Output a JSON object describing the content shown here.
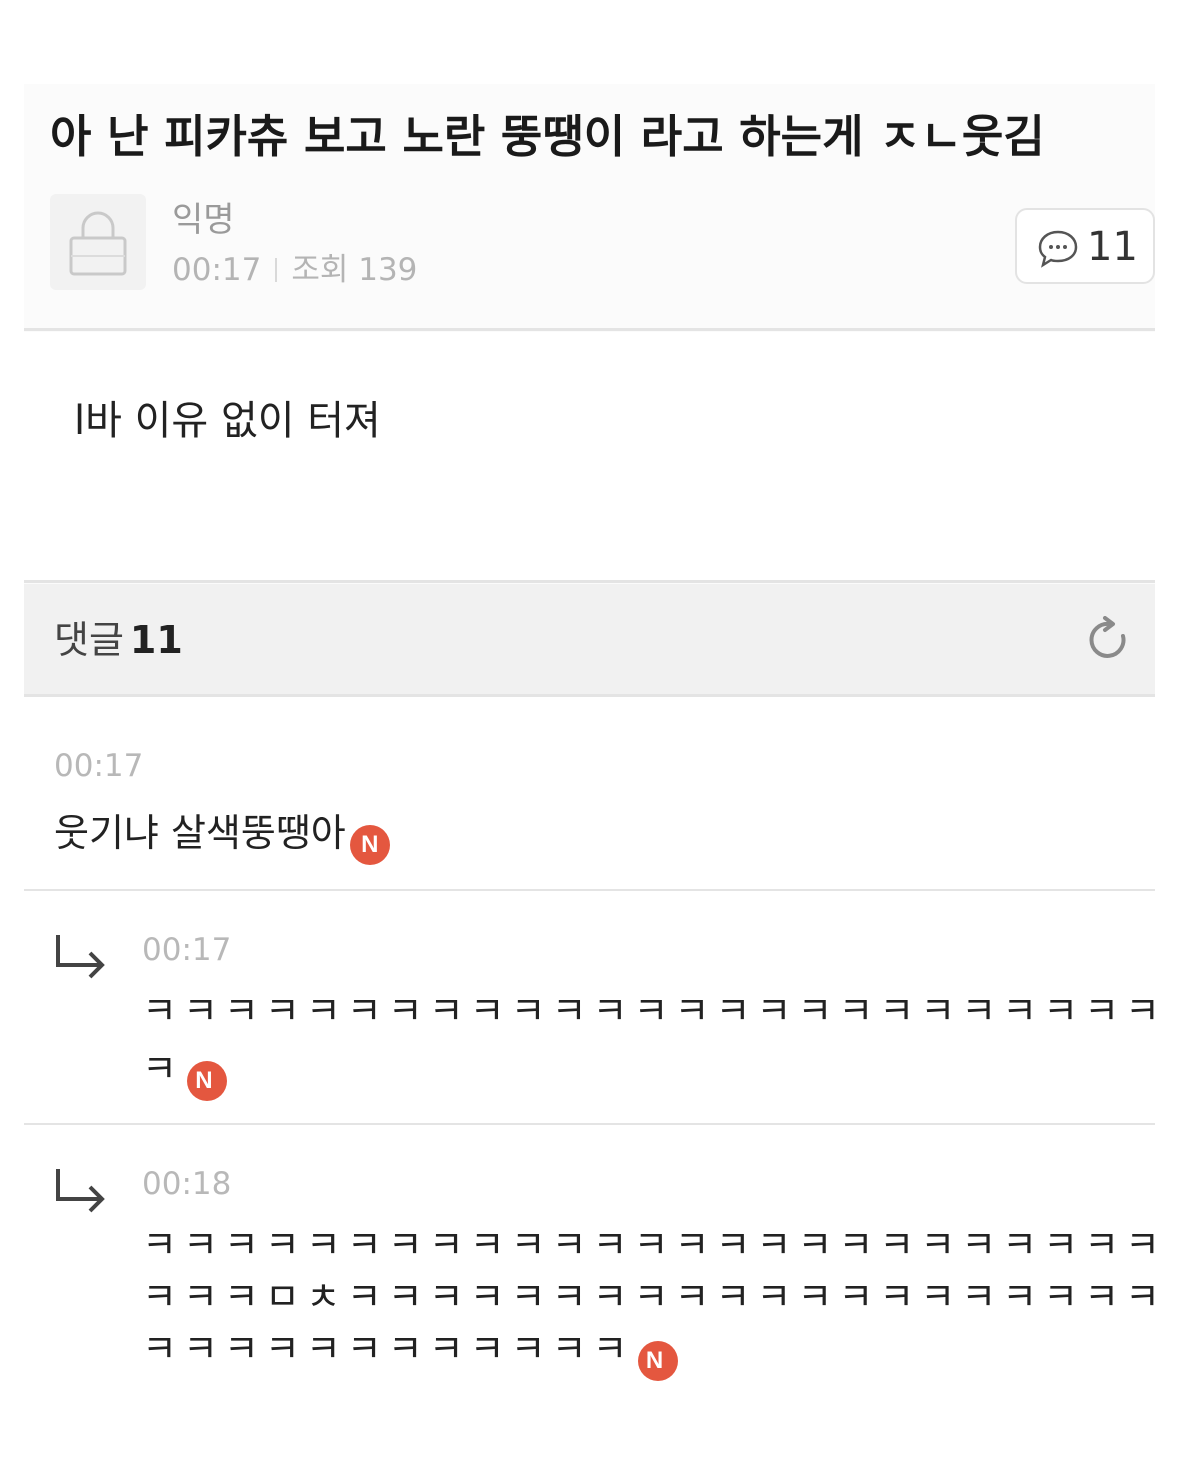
{
  "post": {
    "title": "아 난 피카츄 보고 노란 뚱땡이 라고 하는게 ㅈㄴ웃김",
    "author": "익명",
    "time": "00:17",
    "views_label": "조회 139",
    "comment_count": "11",
    "body": "l바 이유 없이 터져"
  },
  "comments_section": {
    "label": "댓글",
    "count": "11"
  },
  "comments": [
    {
      "time": "00:17",
      "text": "웃기냐 살색뚱땡아",
      "badge": "N"
    },
    {
      "time": "00:17",
      "lines": [
        "ㅋㅋㅋㅋㅋㅋㅋㅋㅋㅋㅋㅋㅋㅋㅋㅋㅋㅋㅋㅋㅋㅋㅋㅋㅋㅋ",
        "ㅋ"
      ],
      "badge": "N"
    },
    {
      "time": "00:18",
      "lines": [
        "ㅋㅋㅋㅋㅋㅋㅋㅋㅋㅋㅋㅋㅋㅋㅋㅋㅋㅋㅋㅋㅋㅋㅋㅋㅋㅋ",
        "ㅋㅋㅋㅁㅊㅋㅋㅋㅋㅋㅋㅋㅋㅋㅋㅋㅋㅋㅋㅋㅋㅋㅋㅋㅋ",
        "ㅋㅋㅋㅋㅋㅋㅋㅋㅋㅋㅋㅋ"
      ],
      "badge": "N"
    }
  ],
  "colors": {
    "badge": "#e4573f",
    "meta_text": "#b4b4b4",
    "header_bg": "#f1f1f1"
  },
  "icons": {
    "avatar": "lock-icon",
    "comment_button": "speech-bubble-icon",
    "refresh": "refresh-icon",
    "reply": "reply-arrow-icon"
  }
}
